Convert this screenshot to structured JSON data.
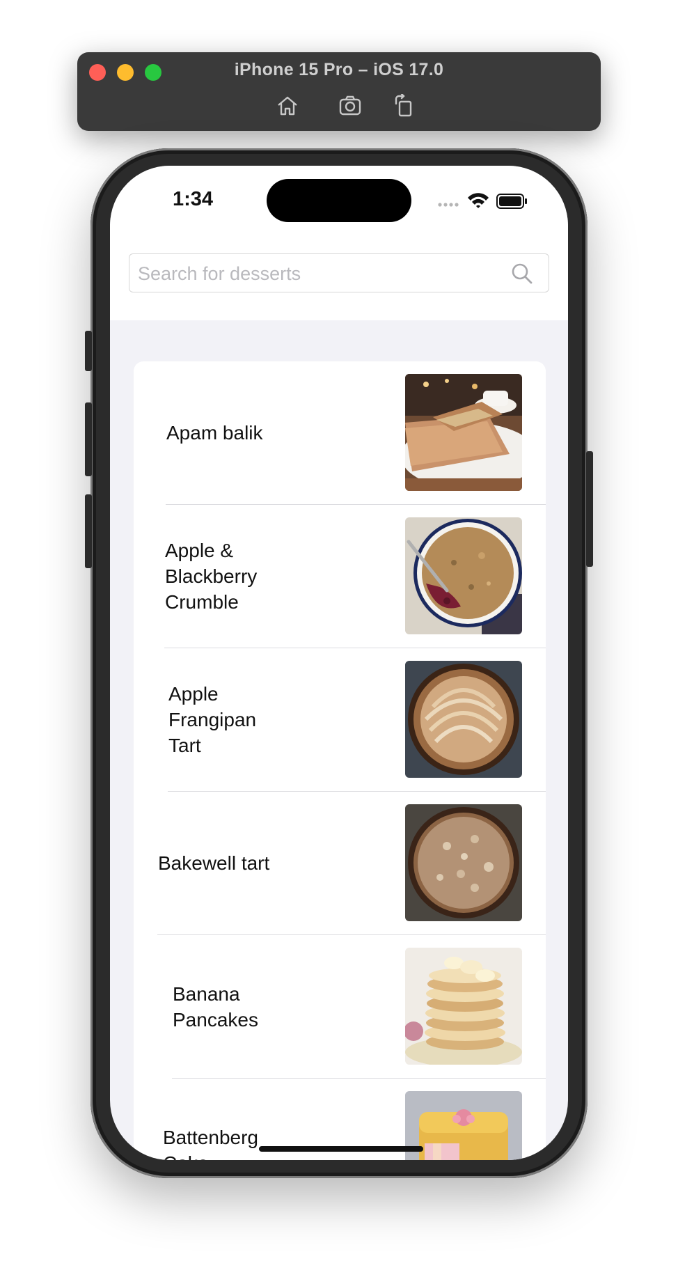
{
  "simulator": {
    "title": "iPhone 15 Pro – iOS 17.0",
    "tools": [
      "home-icon",
      "screenshot-icon",
      "rotate-icon"
    ]
  },
  "status_bar": {
    "time": "1:34"
  },
  "search": {
    "placeholder": "Search for desserts",
    "value": ""
  },
  "desserts": [
    {
      "name_lines": [
        "Apam balik"
      ],
      "image": "apam-balik-photo"
    },
    {
      "name_lines": [
        "Apple &",
        "Blackberry",
        "Crumble"
      ],
      "image": "crumble-photo"
    },
    {
      "name_lines": [
        "Apple",
        "Frangipan",
        "Tart"
      ],
      "image": "frangipan-tart-photo"
    },
    {
      "name_lines": [
        "Bakewell tart"
      ],
      "image": "bakewell-tart-photo"
    },
    {
      "name_lines": [
        "Banana",
        "Pancakes"
      ],
      "image": "pancakes-photo"
    },
    {
      "name_lines": [
        "Battenberg",
        "Cake"
      ],
      "image": "battenberg-photo"
    }
  ],
  "colors": {
    "background": "#f2f2f7",
    "card": "#ffffff",
    "separator": "#dcdce0",
    "placeholder": "#b9b9bd"
  }
}
